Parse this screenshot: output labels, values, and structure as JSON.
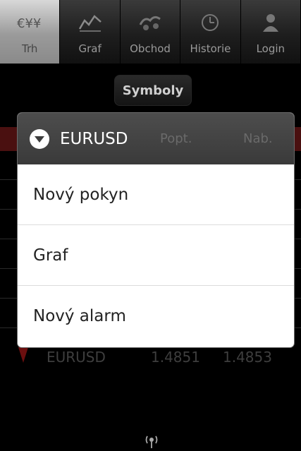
{
  "tabs": [
    {
      "label": "Trh",
      "icon": "market-icon",
      "active": true
    },
    {
      "label": "Graf",
      "icon": "chart-icon",
      "active": false
    },
    {
      "label": "Obchod",
      "icon": "trade-icon",
      "active": false
    },
    {
      "label": "Historie",
      "icon": "history-icon",
      "active": false
    },
    {
      "label": "Login",
      "icon": "login-icon",
      "active": false
    }
  ],
  "market": {
    "symbols_button": "Symboly",
    "header_columns": [
      "Popt.",
      "Nab."
    ],
    "visible_row": {
      "symbol": "EURUSD",
      "bid": "1.4851",
      "ask": "1.4853"
    }
  },
  "dialog": {
    "title": "EURUSD",
    "items": [
      {
        "label": "Nový pokyn"
      },
      {
        "label": "Graf"
      },
      {
        "label": "Nový alarm"
      }
    ]
  }
}
